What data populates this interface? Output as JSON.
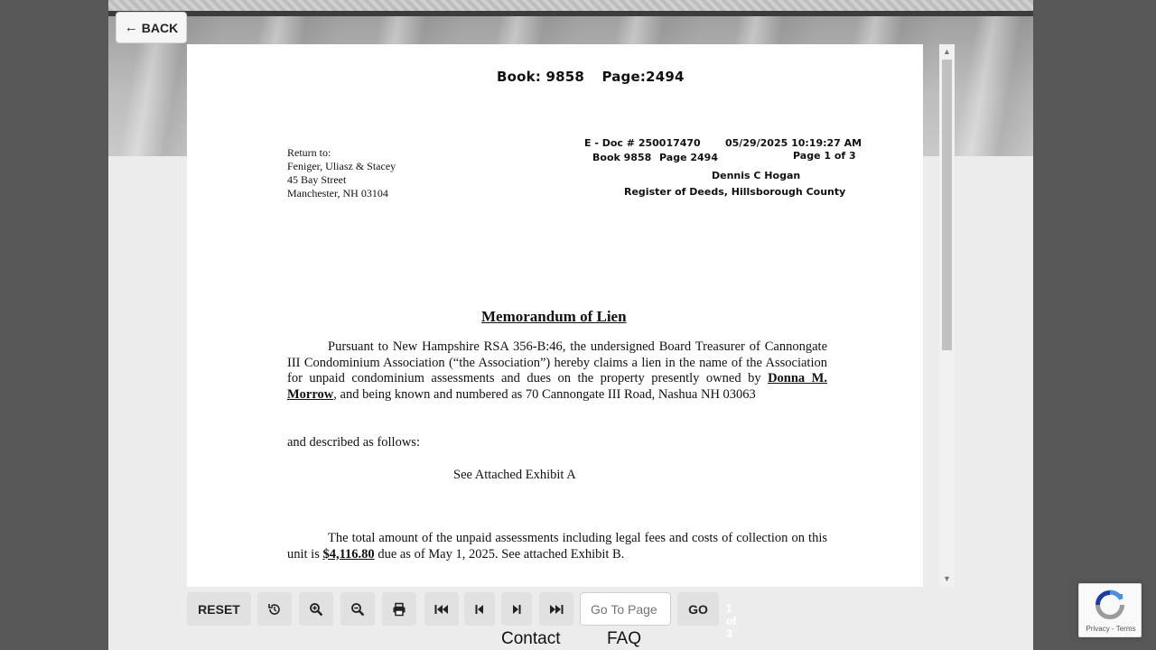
{
  "back_button": {
    "label": "BACK",
    "icon": "arrow-left-icon"
  },
  "document": {
    "book_label": "Book: 9858",
    "page_label": "Page:2494",
    "return_to": [
      "Return to:",
      "Feniger, Uliasz & Stacey",
      "45 Bay Street",
      "Manchester, NH 03104"
    ],
    "recording": {
      "edoc": "E - Doc # 250017470",
      "datetime": "05/29/2025 10:19:27 AM",
      "book": "Book 9858",
      "page": "Page 2494",
      "page_of": "Page 1 of 3",
      "name": "Dennis C Hogan",
      "office": "Register of Deeds, Hillsborough County"
    },
    "title": "Memorandum of Lien",
    "para1_a": "Pursuant to New Hampshire RSA 356-B:46, the undersigned Board Treasurer of Cannongate III Condominium Association (“the Association”) hereby claims a lien in the name of the Association for unpaid condominium assessments and dues on the property presently owned by ",
    "owner": "Donna M. Morrow",
    "para1_b": ", and being known and numbered as 70 Cannongate III Road, Nashua NH 03063",
    "para2": "and described as follows:",
    "exhibit": "See Attached Exhibit A",
    "para3_a": "The total amount of the unpaid assessments including legal fees and costs of collection on this unit is ",
    "amount": "$4,116.80",
    "para3_b": " due as of May 1, 2025. See attached Exhibit B."
  },
  "toolbar": {
    "reset_label": "RESET",
    "rotate_icon": "rotate-icon",
    "zoom_in_icon": "zoom-in-icon",
    "zoom_out_icon": "zoom-out-icon",
    "print_icon": "print-icon",
    "first_icon": "first-page-icon",
    "prev_icon": "previous-page-icon",
    "next_icon": "next-page-icon",
    "last_icon": "last-page-icon",
    "goto_placeholder": "Go To Page",
    "go_label": "GO",
    "page_count": "1 of 3"
  },
  "footer": {
    "contact": "Contact",
    "faq": "FAQ"
  },
  "recaptcha": {
    "privacy": "Privacy",
    "separator": " - ",
    "terms": "Terms"
  }
}
